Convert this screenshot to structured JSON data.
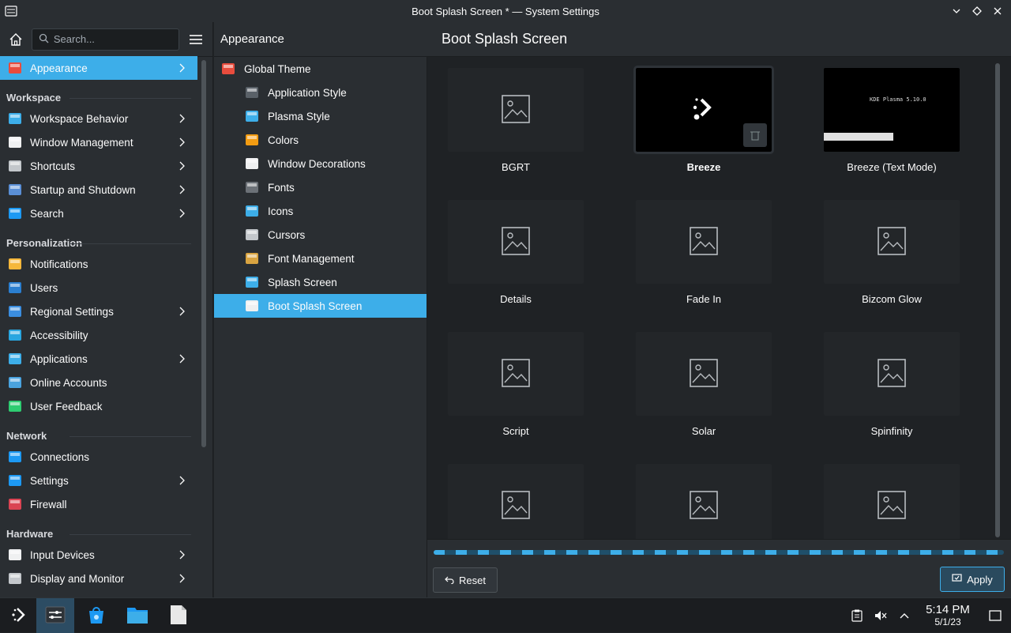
{
  "window": {
    "title": "Boot Splash Screen * — System Settings"
  },
  "sidebar": {
    "search_placeholder": "Search...",
    "items": [
      {
        "label": "Appearance",
        "active": true,
        "chevron": true
      },
      {
        "section": "Workspace"
      },
      {
        "label": "Workspace Behavior",
        "chevron": true
      },
      {
        "label": "Window Management",
        "chevron": true
      },
      {
        "label": "Shortcuts",
        "chevron": true
      },
      {
        "label": "Startup and Shutdown",
        "chevron": true
      },
      {
        "label": "Search",
        "chevron": true
      },
      {
        "section": "Personalization"
      },
      {
        "label": "Notifications",
        "chevron": false
      },
      {
        "label": "Users",
        "chevron": false
      },
      {
        "label": "Regional Settings",
        "chevron": true
      },
      {
        "label": "Accessibility",
        "chevron": false
      },
      {
        "label": "Applications",
        "chevron": true
      },
      {
        "label": "Online Accounts",
        "chevron": false
      },
      {
        "label": "User Feedback",
        "chevron": false
      },
      {
        "section": "Network"
      },
      {
        "label": "Connections",
        "chevron": false
      },
      {
        "label": "Settings",
        "chevron": true
      },
      {
        "label": "Firewall",
        "chevron": false
      },
      {
        "section": "Hardware"
      },
      {
        "label": "Input Devices",
        "chevron": true
      },
      {
        "label": "Display and Monitor",
        "chevron": true
      }
    ]
  },
  "middle": {
    "title": "Appearance",
    "items": [
      {
        "label": "Global Theme",
        "top": true
      },
      {
        "label": "Application Style"
      },
      {
        "label": "Plasma Style"
      },
      {
        "label": "Colors"
      },
      {
        "label": "Window Decorations"
      },
      {
        "label": "Fonts"
      },
      {
        "label": "Icons"
      },
      {
        "label": "Cursors"
      },
      {
        "label": "Font Management"
      },
      {
        "label": "Splash Screen"
      },
      {
        "label": "Boot Splash Screen",
        "active": true
      }
    ]
  },
  "content": {
    "title": "Boot Splash Screen",
    "themes": [
      {
        "label": "BGRT"
      },
      {
        "label": "Breeze",
        "selected": true,
        "preview": "breeze"
      },
      {
        "label": "Breeze (Text Mode)",
        "preview": "text",
        "preview_text": "KDE Plasma 5.10.0"
      },
      {
        "label": "Details"
      },
      {
        "label": "Fade In"
      },
      {
        "label": "Bizcom Glow"
      },
      {
        "label": "Script"
      },
      {
        "label": "Solar"
      },
      {
        "label": "Spinfinity"
      },
      {
        "label": ""
      },
      {
        "label": ""
      },
      {
        "label": ""
      }
    ]
  },
  "footer": {
    "reset_label": "Reset",
    "apply_label": "Apply"
  },
  "taskbar": {
    "time": "5:14 PM",
    "date": "5/1/23"
  },
  "colors": {
    "accent": "#3daee9",
    "bg": "#202326",
    "panel": "#2a2e32"
  }
}
